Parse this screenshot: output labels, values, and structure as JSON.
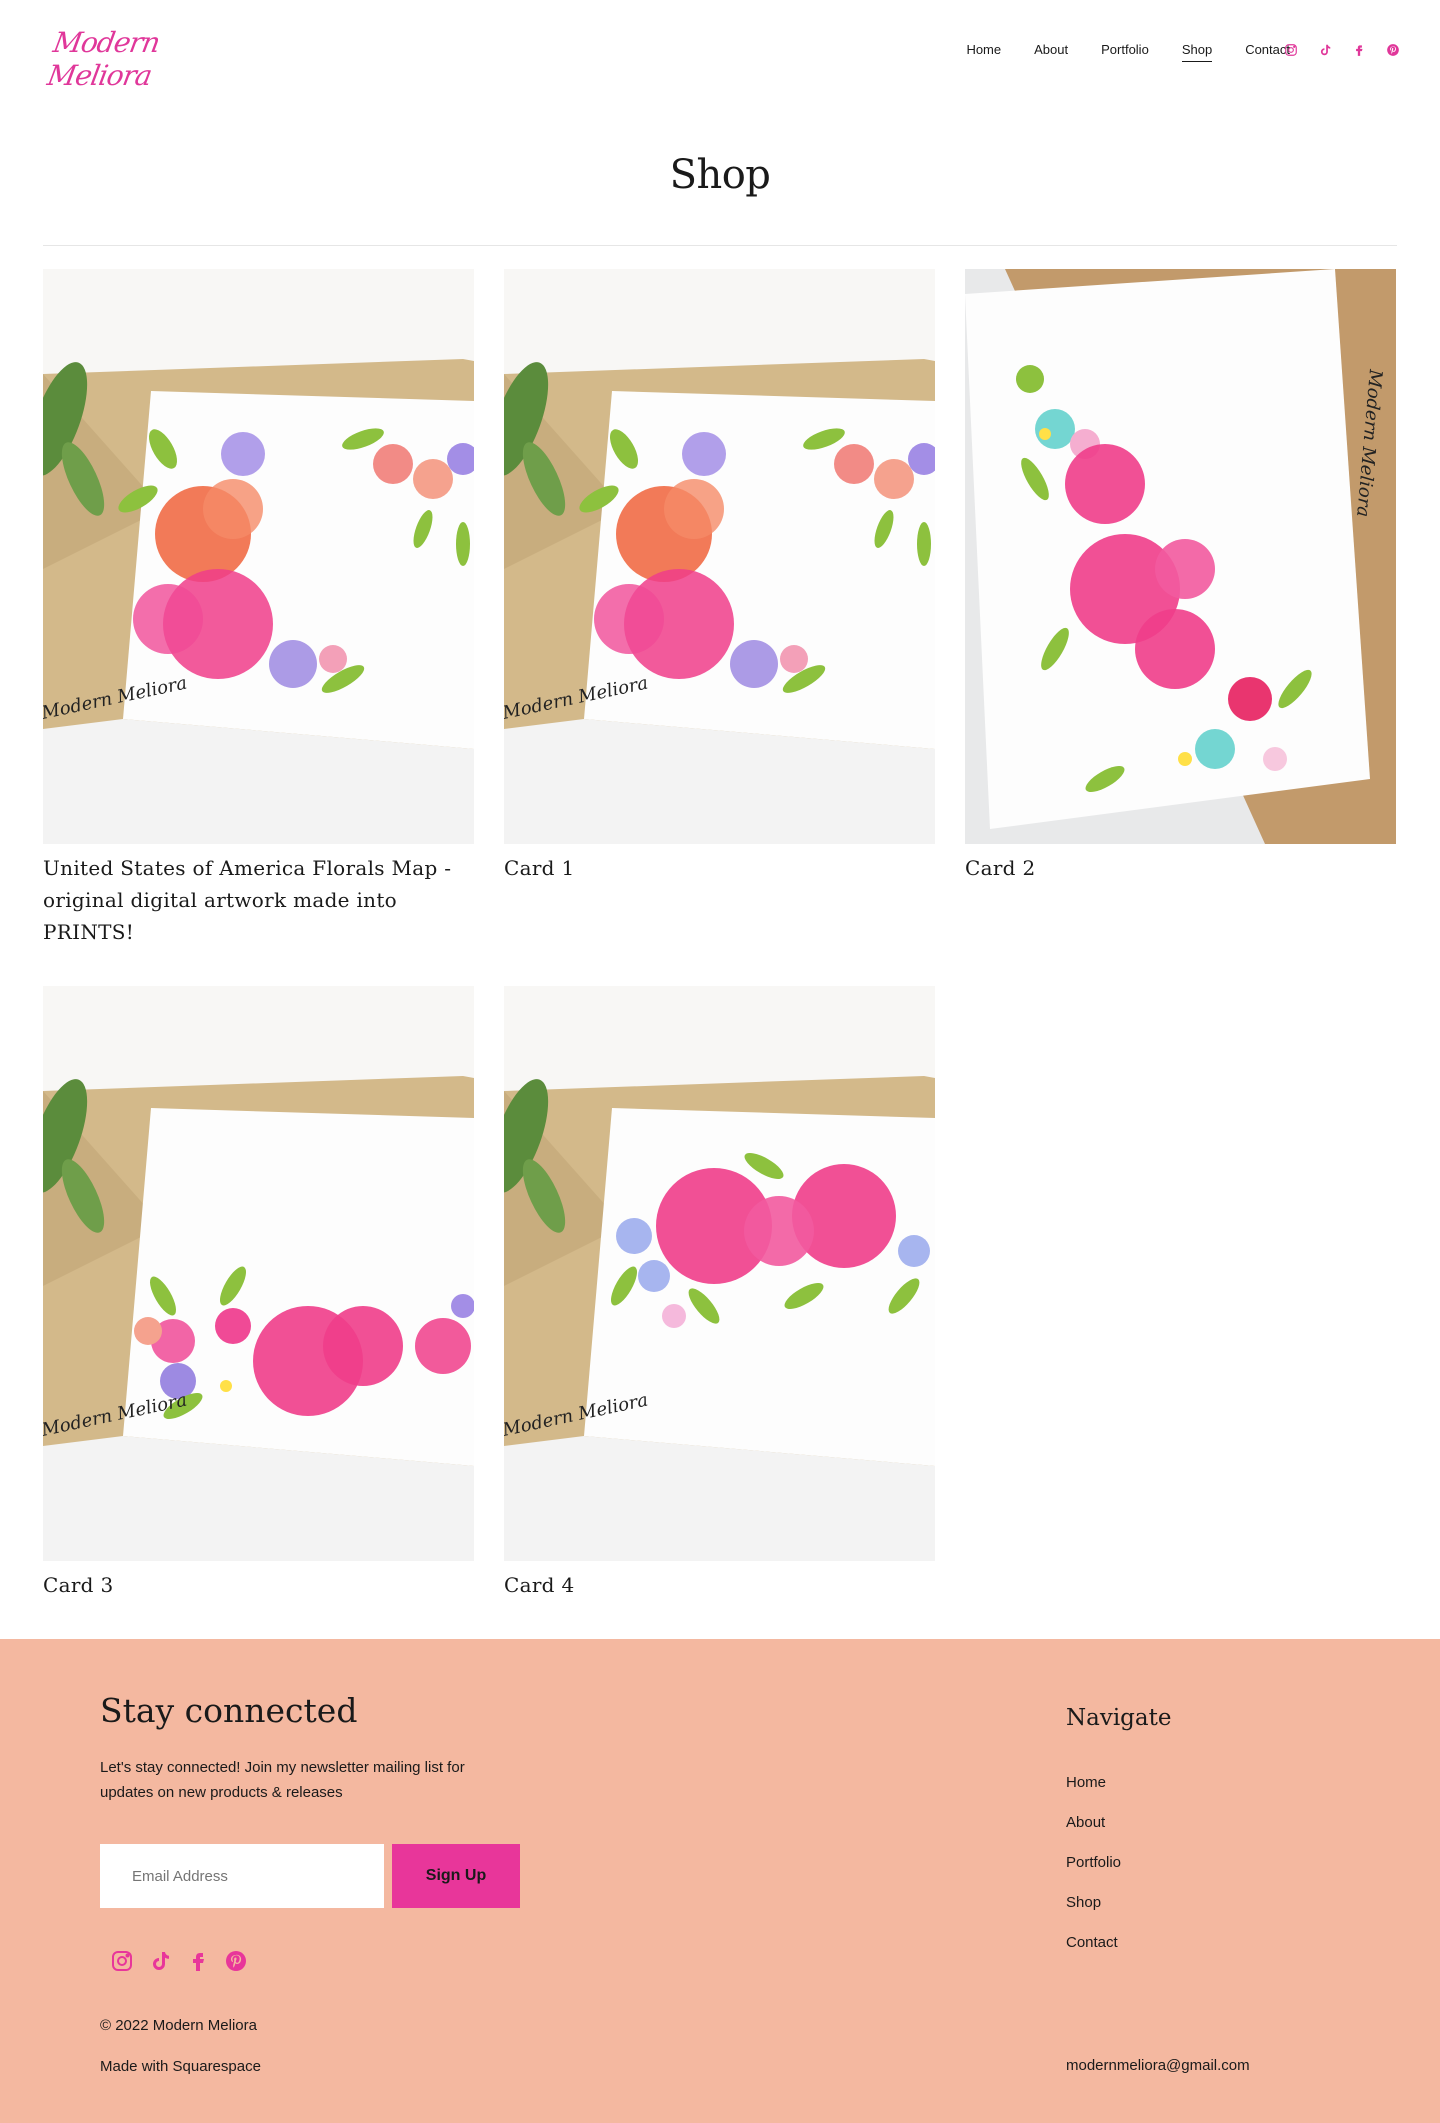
{
  "header": {
    "logo_text": "Modern Meliora",
    "nav": [
      {
        "label": "Home",
        "active": false
      },
      {
        "label": "About",
        "active": false
      },
      {
        "label": "Portfolio",
        "active": false
      },
      {
        "label": "Shop",
        "active": true
      },
      {
        "label": "Contact",
        "active": false
      }
    ],
    "social_icons": [
      "instagram-icon",
      "tiktok-icon",
      "facebook-icon",
      "pinterest-icon"
    ],
    "accent_color": "#e0379a"
  },
  "page": {
    "title": "Shop"
  },
  "products": [
    {
      "title": "United States of America Florals Map - original digital artwork made into PRINTS!",
      "signature": "Modern Meliora"
    },
    {
      "title": "Card 1",
      "signature": "Modern Meliora"
    },
    {
      "title": "Card 2",
      "signature": "Modern Meliora"
    },
    {
      "title": "Card 3",
      "signature": "Modern Meliora"
    },
    {
      "title": "Card 4",
      "signature": "Modern Meliora"
    }
  ],
  "footer": {
    "heading": "Stay connected",
    "description": "Let's stay connected! Join my newsletter mailing list for updates on new products & releases",
    "email_placeholder": "Email Address",
    "signup_label": "Sign Up",
    "social_icons": [
      "instagram-icon",
      "tiktok-icon",
      "facebook-icon",
      "pinterest-icon"
    ],
    "copyright": "© 2022 Modern Meliora",
    "made_with": "Made with Squarespace",
    "nav_heading": "Navigate",
    "nav": [
      "Home",
      "About",
      "Portfolio",
      "Shop",
      "Contact"
    ],
    "email": "modernmeliora@gmail.com",
    "background": "#f4b8a0",
    "button_color": "#e8369a"
  }
}
